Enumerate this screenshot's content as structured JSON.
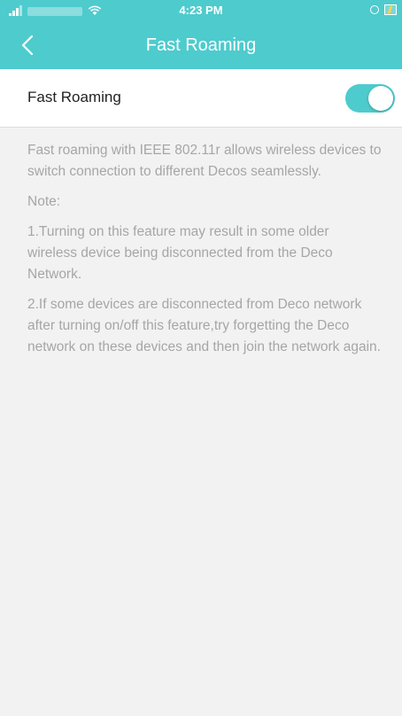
{
  "status_bar": {
    "time": "4:23 PM"
  },
  "nav": {
    "title": "Fast Roaming"
  },
  "setting": {
    "label": "Fast Roaming",
    "enabled": true
  },
  "description": {
    "intro": "Fast roaming with IEEE 802.11r allows wireless devices to switch connection to different Decos seamlessly.",
    "note_label": "Note:",
    "note1": "1.Turning on this feature may result in some older wireless device being disconnected  from the Deco Network.",
    "note2": "2.If some devices are disconnected from Deco network after turning on/off this feature,try forgetting the Deco network on these devices and then join the network again."
  },
  "colors": {
    "accent": "#4ecbcd",
    "background": "#f2f2f2",
    "muted_text": "#a6a6a6"
  },
  "icons": [
    "signal-icon",
    "wifi-icon",
    "alarm-icon",
    "battery-icon",
    "back-chevron-icon"
  ]
}
